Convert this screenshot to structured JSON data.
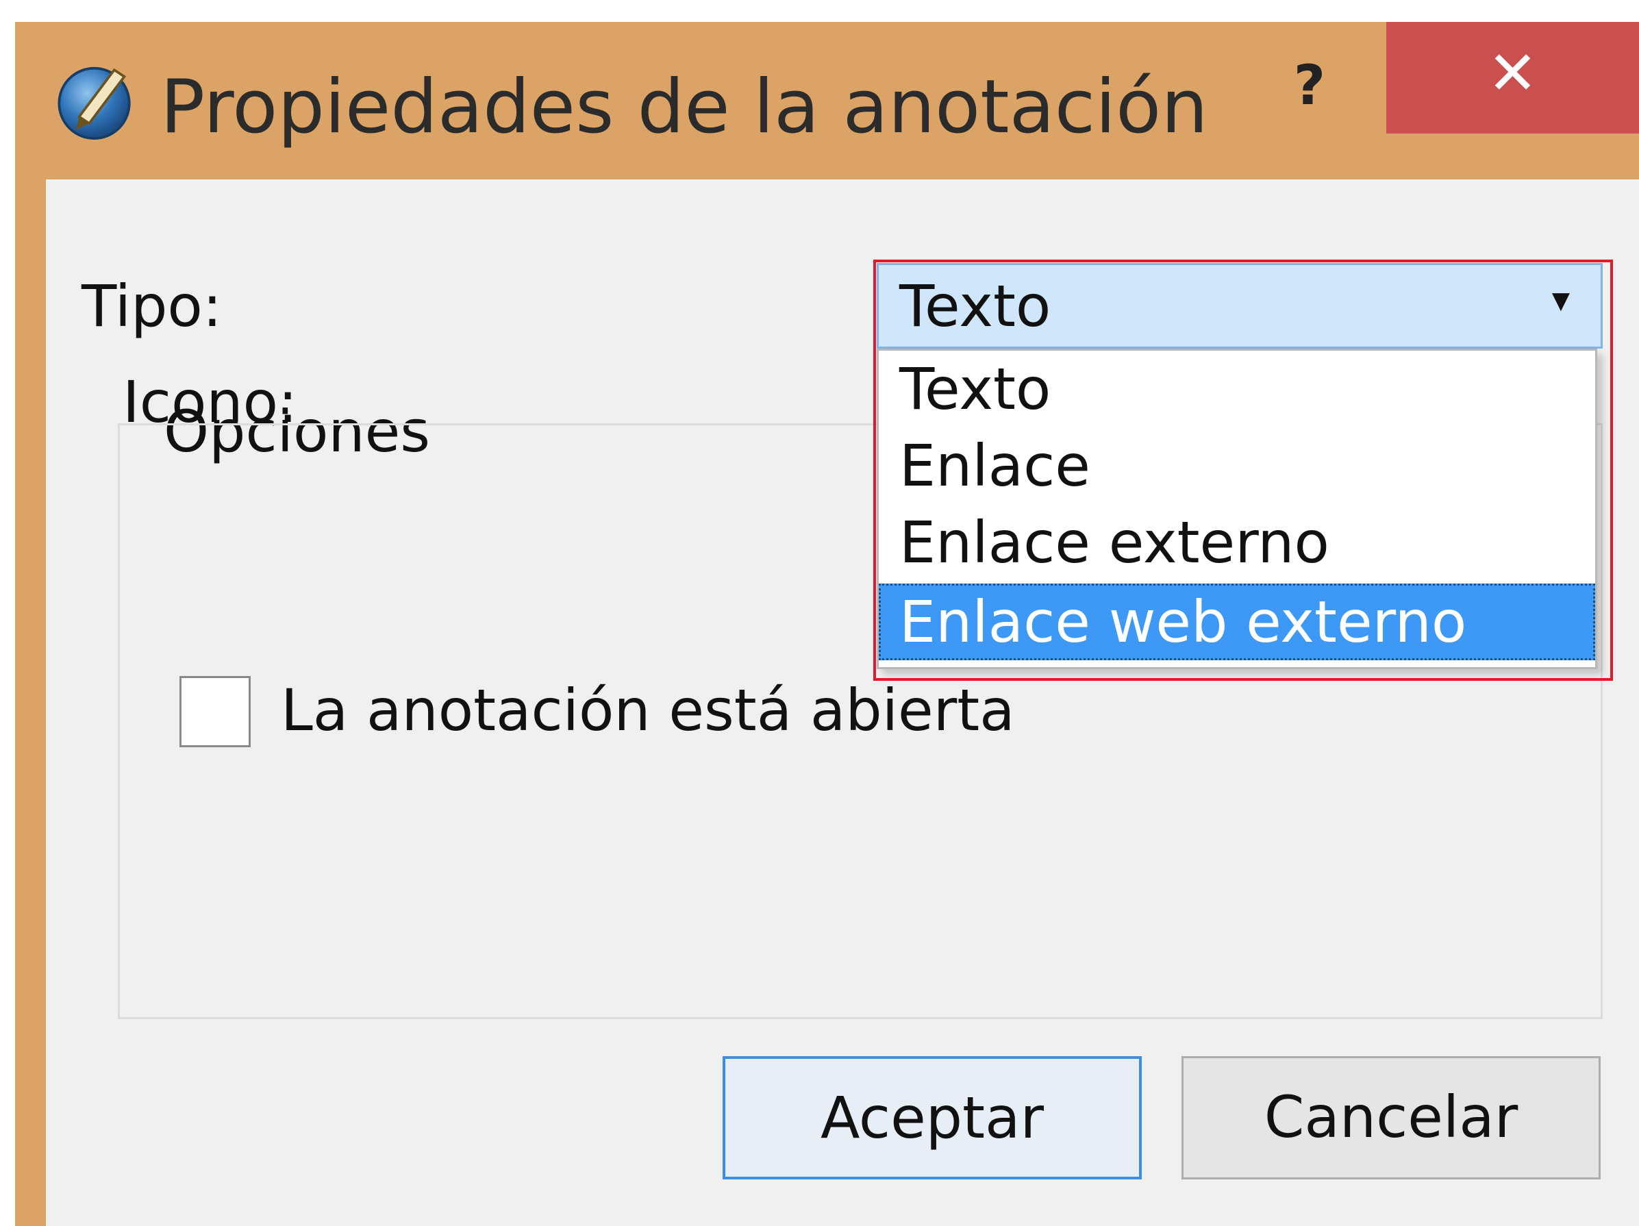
{
  "window": {
    "title": "Propiedades de la anotación",
    "help_glyph": "?",
    "close_glyph": "✕",
    "app_icon": "annotation-pen-icon"
  },
  "form": {
    "type_label": "Tipo:",
    "type_value": "Texto",
    "type_options": [
      "Texto",
      "Enlace",
      "Enlace externo",
      "Enlace web externo"
    ],
    "highlighted_option": "Enlace web externo",
    "options_group_title": "Opciones",
    "icon_label": "Icono:",
    "open_checkbox_label": "La anotación está abierta",
    "open_checkbox_checked": false
  },
  "buttons": {
    "ok_label": "Aceptar",
    "cancel_label": "Cancelar"
  },
  "colors": {
    "window_frame": "#dba466",
    "close_button": "#c9504f",
    "selection": "#3d99f5",
    "annotation_box": "#e21b2b"
  }
}
